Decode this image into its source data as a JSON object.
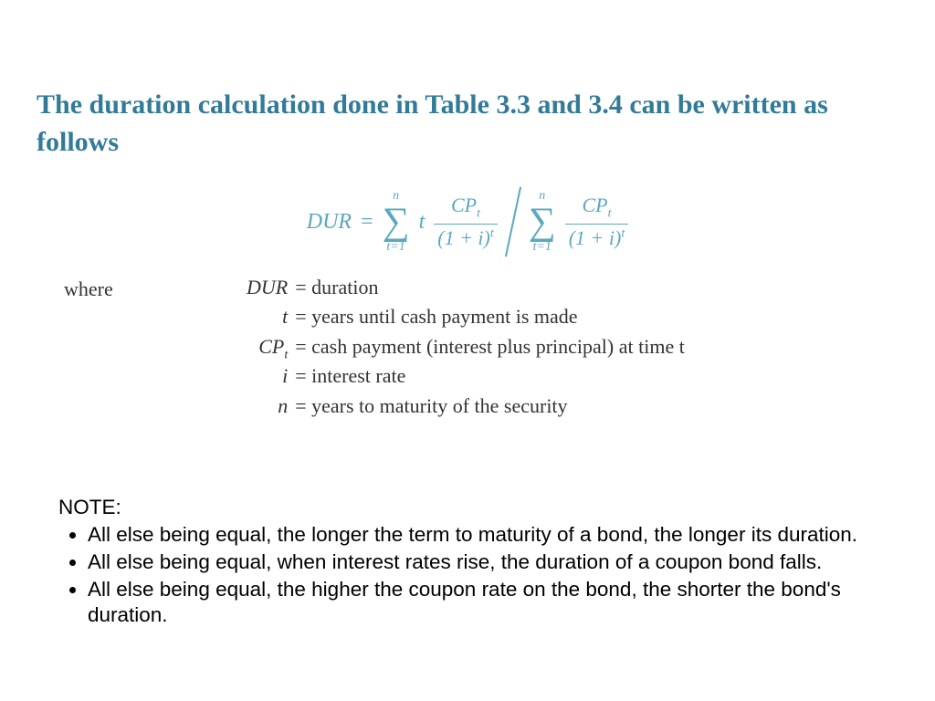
{
  "title": "The duration calculation done in Table 3.3 and 3.4  can be written as follows",
  "formula": {
    "lhs": "DUR",
    "eq": "=",
    "sigma_upper": "n",
    "sigma_lower": "t=1",
    "t_factor": "t",
    "frac_num": "CP",
    "frac_num_sub": "t",
    "frac_den_base": "(1 + i)",
    "frac_den_exp": "t"
  },
  "where_label": "where",
  "definitions": [
    {
      "sym": "DUR",
      "sub": "",
      "desc": "= duration"
    },
    {
      "sym": "t",
      "sub": "",
      "desc": "= years until cash payment is made"
    },
    {
      "sym": "CP",
      "sub": "t",
      "desc": "= cash payment (interest plus principal) at time t"
    },
    {
      "sym": "i",
      "sub": "",
      "desc": "= interest rate"
    },
    {
      "sym": "n",
      "sub": "",
      "desc": "= years to maturity of the security"
    }
  ],
  "note_label": "NOTE:",
  "notes": [
    "All else being equal, the longer the term to maturity of a bond, the longer its duration.",
    "All else being equal, when interest rates rise, the duration of a coupon bond falls.",
    "All else being equal, the higher the coupon rate on the bond, the shorter the bond's duration."
  ]
}
